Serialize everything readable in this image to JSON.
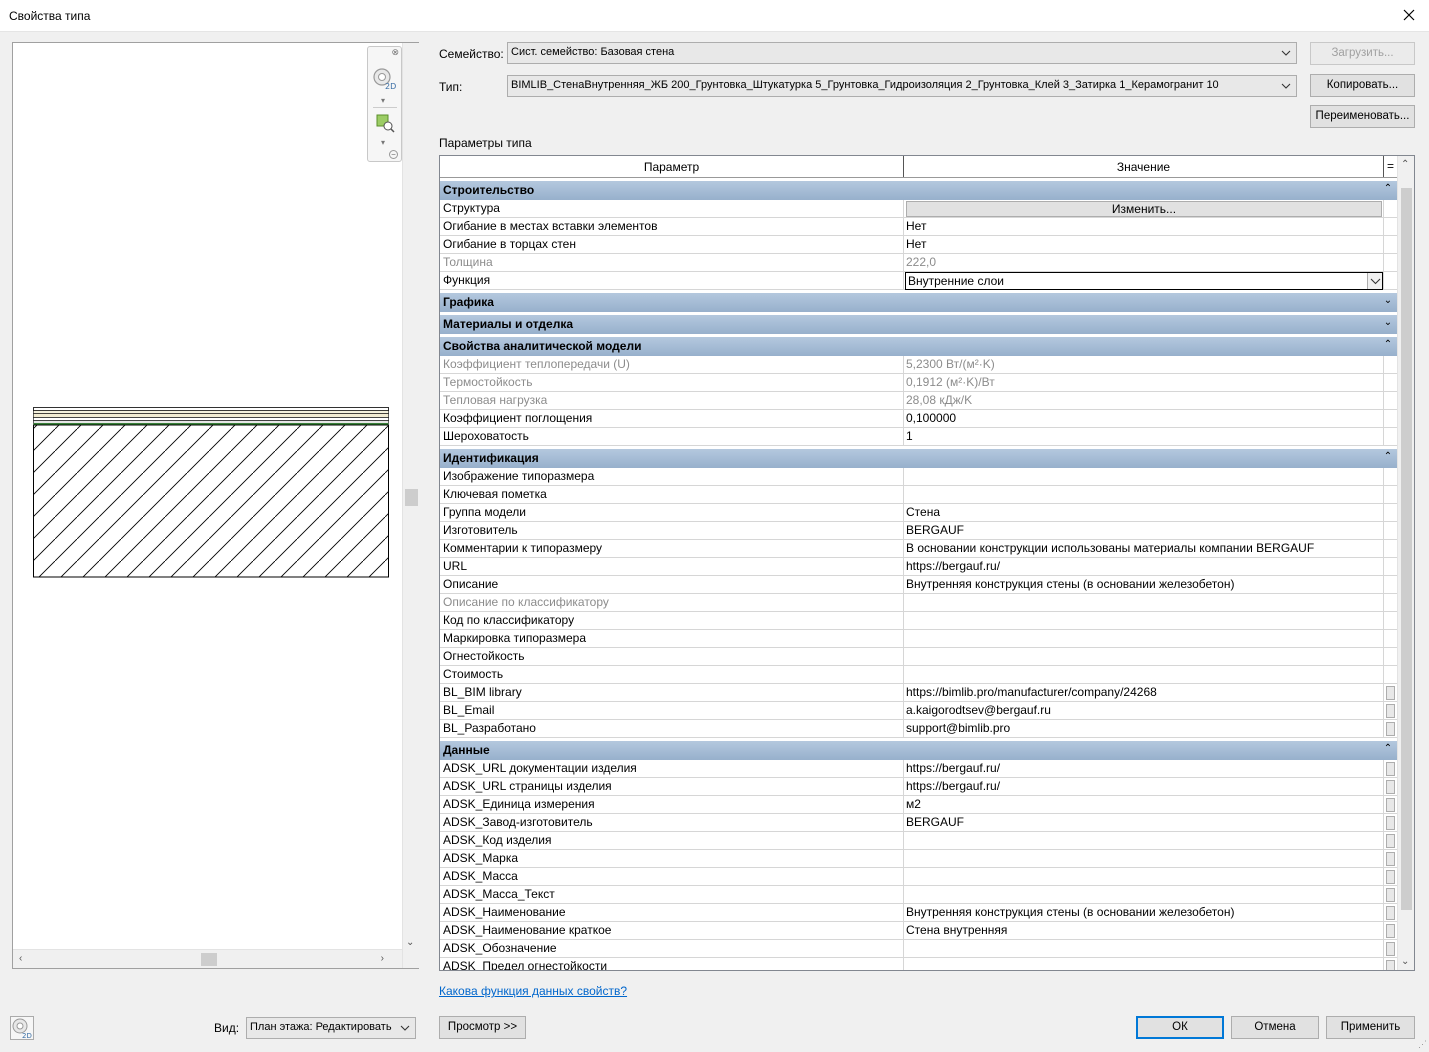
{
  "window": {
    "title": "Свойства типа"
  },
  "form": {
    "family_label": "Семейство:",
    "family_value": "Сист. семейство: Базовая стена",
    "type_label": "Тип:",
    "type_value": "BIMLIB_СтенаВнутренняя_ЖБ 200_Грунтовка_Штукатурка 5_Грунтовка_Гидроизоляция 2_Грунтовка_Клей 3_Затирка 1_Керамогранит 10",
    "load_button": "Загрузить...",
    "copy_button": "Копировать...",
    "rename_button": "Переименовать...",
    "type_params_label": "Параметры типа"
  },
  "table": {
    "col_param": "Параметр",
    "col_value": "Значение",
    "col_marker": "=",
    "groups": [
      {
        "name": "Строительство",
        "toggle": "⌃",
        "rows": [
          {
            "p": "Структура",
            "v": "Изменить...",
            "kind": "button"
          },
          {
            "p": "Огибание в местах вставки элементов",
            "v": "Нет"
          },
          {
            "p": "Огибание в торцах стен",
            "v": "Нет"
          },
          {
            "p": "Толщина",
            "v": "222,0",
            "gray": true
          },
          {
            "p": "Функция",
            "v": "Внутренние слои",
            "kind": "combo"
          }
        ]
      },
      {
        "name": "Графика",
        "toggle": "⌄",
        "rows": []
      },
      {
        "name": "Материалы и отделка",
        "toggle": "⌄",
        "rows": []
      },
      {
        "name": "Свойства аналитической модели",
        "toggle": "⌃",
        "rows": [
          {
            "p": "Коэффициент теплопередачи (U)",
            "v": "5,2300 Вт/(м²·K)",
            "gray": true
          },
          {
            "p": "Термостойкость",
            "v": "0,1912 (м²·K)/Вт",
            "gray": true
          },
          {
            "p": "Тепловая нагрузка",
            "v": "28,08 кДж/K",
            "gray": true
          },
          {
            "p": "Коэффициент поглощения",
            "v": "0,100000"
          },
          {
            "p": "Шероховатость",
            "v": "1"
          }
        ]
      },
      {
        "name": "Идентификация",
        "toggle": "⌃",
        "rows": [
          {
            "p": "Изображение типоразмера",
            "v": ""
          },
          {
            "p": "Ключевая пометка",
            "v": ""
          },
          {
            "p": "Группа модели",
            "v": "Стена"
          },
          {
            "p": "Изготовитель",
            "v": "BERGAUF"
          },
          {
            "p": "Комментарии к типоразмеру",
            "v": "В основании конструкции использованы материалы компании BERGAUF"
          },
          {
            "p": "URL",
            "v": "https://bergauf.ru/"
          },
          {
            "p": "Описание",
            "v": "Внутренняя конструкция стены (в основании железобетон)"
          },
          {
            "p": "Описание по классификатору",
            "v": "",
            "gray": true
          },
          {
            "p": "Код по классификатору",
            "v": ""
          },
          {
            "p": "Маркировка типоразмера",
            "v": ""
          },
          {
            "p": "Огнестойкость",
            "v": ""
          },
          {
            "p": "Стоимость",
            "v": ""
          },
          {
            "p": "BL_BIM library",
            "v": "https://bimlib.pro/manufacturer/company/24268",
            "mark": true
          },
          {
            "p": "BL_Email",
            "v": "a.kaigorodtsev@bergauf.ru",
            "mark": true
          },
          {
            "p": "BL_Разработано",
            "v": "support@bimlib.pro",
            "mark": true
          }
        ]
      },
      {
        "name": "Данные",
        "toggle": "⌃",
        "rows": [
          {
            "p": "ADSK_URL документации изделия",
            "v": "https://bergauf.ru/",
            "mark": true
          },
          {
            "p": "ADSK_URL страницы изделия",
            "v": "https://bergauf.ru/",
            "mark": true
          },
          {
            "p": "ADSK_Единица измерения",
            "v": "м2",
            "mark": true
          },
          {
            "p": "ADSK_Завод-изготовитель",
            "v": "BERGAUF",
            "mark": true
          },
          {
            "p": "ADSK_Код изделия",
            "v": "",
            "mark": true
          },
          {
            "p": "ADSK_Марка",
            "v": "",
            "mark": true
          },
          {
            "p": "ADSK_Масса",
            "v": "",
            "mark": true
          },
          {
            "p": "ADSK_Масса_Текст",
            "v": "",
            "mark": true
          },
          {
            "p": "ADSK_Наименование",
            "v": "Внутренняя конструкция стены (в основании железобетон)",
            "mark": true
          },
          {
            "p": "ADSK_Наименование краткое",
            "v": "Стена внутренняя",
            "mark": true
          },
          {
            "p": "ADSK_Обозначение",
            "v": "",
            "mark": true
          },
          {
            "p": "ADSK_Предел огнестойкости",
            "v": "",
            "mark": true
          }
        ]
      }
    ]
  },
  "footer": {
    "help_link": "Какова функция данных свойств?",
    "view_label": "Вид:",
    "view_value": "План этажа: Редактировать",
    "preview_button": "Просмотр >>",
    "ok_button": "ОК",
    "cancel_button": "Отмена",
    "apply_button": "Применить"
  },
  "icons": {
    "close": "close-icon",
    "steering_wheel": "steering-wheel-icon",
    "zoom": "zoom-region-icon"
  }
}
